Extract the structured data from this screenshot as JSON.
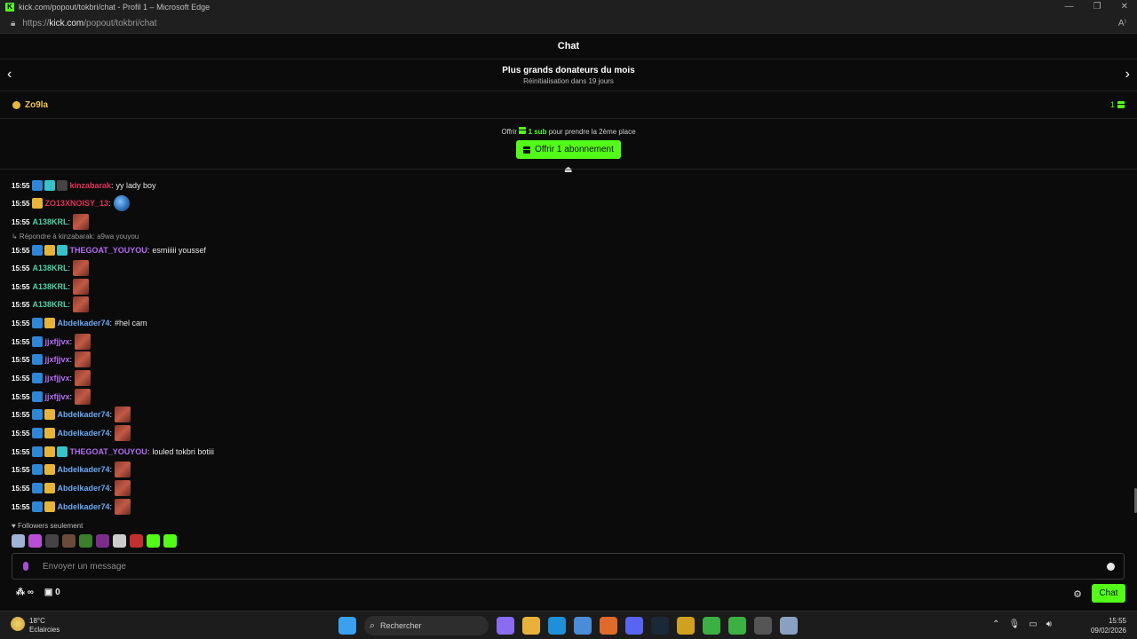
{
  "browser": {
    "window_title": "kick.com/popout/tokbri/chat - Profil 1 – Microsoft Edge",
    "url_prefix": "https://",
    "url_host": "kick.com",
    "url_path": "/popout/tokbri/chat"
  },
  "chat": {
    "header_title": "Chat",
    "leaderboard_title": "Plus grands donateurs du mois",
    "leaderboard_subtitle": "Réinitialisation dans 19 jours",
    "top_donor_name": "Zo9la",
    "top_donor_count": "1",
    "offer_prefix": "Offrir",
    "offer_amount": "1 sub",
    "offer_suffix": "pour prendre la 2ème place",
    "offer_button": "Offrir 1 abonnement"
  },
  "messages": [
    {
      "time": "15:55",
      "user": "kinzabarak",
      "color": "#e0325a",
      "text": "yy lady boy",
      "badges": [
        "blue",
        "cyan",
        "dark"
      ],
      "emote": ""
    },
    {
      "time": "15:55",
      "user": "ZO13XNOISY_13",
      "color": "#e0325a",
      "text": "",
      "badges": [
        "gold"
      ],
      "emote": "globe"
    },
    {
      "time": "15:55",
      "user": "A138KRL",
      "color": "#4fd1a5",
      "text": "",
      "badges": [],
      "emote": "face"
    },
    {
      "time": "15:55",
      "user": "THEGOAT_YOUYOU",
      "color": "#b46cf0",
      "text": "esmiiiii youssef",
      "badges": [
        "blue",
        "gold",
        "cyan"
      ],
      "emote": ""
    },
    {
      "time": "15:55",
      "user": "A138KRL",
      "color": "#4fd1a5",
      "text": "",
      "badges": [],
      "emote": "face"
    },
    {
      "time": "15:55",
      "user": "A138KRL",
      "color": "#4fd1a5",
      "text": "",
      "badges": [],
      "emote": "face"
    },
    {
      "time": "15:55",
      "user": "A138KRL",
      "color": "#4fd1a5",
      "text": "",
      "badges": [],
      "emote": "face"
    },
    {
      "time": "15:55",
      "user": "Abdelkader74",
      "color": "#6aa8f0",
      "text": "#hel cam",
      "badges": [
        "blue",
        "gold"
      ],
      "emote": ""
    },
    {
      "time": "15:55",
      "user": "jjxfjjvx",
      "color": "#b46cf0",
      "text": "",
      "badges": [
        "blue"
      ],
      "emote": "face"
    },
    {
      "time": "15:55",
      "user": "jjxfjjvx",
      "color": "#b46cf0",
      "text": "",
      "badges": [
        "blue"
      ],
      "emote": "face"
    },
    {
      "time": "15:55",
      "user": "jjxfjjvx",
      "color": "#b46cf0",
      "text": "",
      "badges": [
        "blue"
      ],
      "emote": "face"
    },
    {
      "time": "15:55",
      "user": "jjxfjjvx",
      "color": "#b46cf0",
      "text": "",
      "badges": [
        "blue"
      ],
      "emote": "face"
    },
    {
      "time": "15:55",
      "user": "Abdelkader74",
      "color": "#6aa8f0",
      "text": "",
      "badges": [
        "blue",
        "gold"
      ],
      "emote": "face"
    },
    {
      "time": "15:55",
      "user": "Abdelkader74",
      "color": "#6aa8f0",
      "text": "",
      "badges": [
        "blue",
        "gold"
      ],
      "emote": "face"
    },
    {
      "time": "15:55",
      "user": "THEGOAT_YOUYOU",
      "color": "#b46cf0",
      "text": "louled tokbri botiii",
      "badges": [
        "blue",
        "gold",
        "cyan"
      ],
      "emote": ""
    },
    {
      "time": "15:55",
      "user": "Abdelkader74",
      "color": "#6aa8f0",
      "text": "",
      "badges": [
        "blue",
        "gold"
      ],
      "emote": "face"
    },
    {
      "time": "15:55",
      "user": "Abdelkader74",
      "color": "#6aa8f0",
      "text": "",
      "badges": [
        "blue",
        "gold"
      ],
      "emote": "face"
    },
    {
      "time": "15:55",
      "user": "Abdelkader74",
      "color": "#6aa8f0",
      "text": "",
      "badges": [
        "blue",
        "gold"
      ],
      "emote": "face"
    }
  ],
  "reply_notice": "↳ Répondre à kinzabarak: a9wa youyou",
  "followers_notice": "♥ Followers seulement",
  "input_placeholder": "Envoyer un message",
  "bottom": {
    "infinity": "∞",
    "points": "0",
    "chat_button": "Chat"
  },
  "taskbar": {
    "temperature": "18°C",
    "weather": "Eclaircies",
    "search": "Rechercher",
    "time": "15:55",
    "date": "09/02/2026"
  }
}
